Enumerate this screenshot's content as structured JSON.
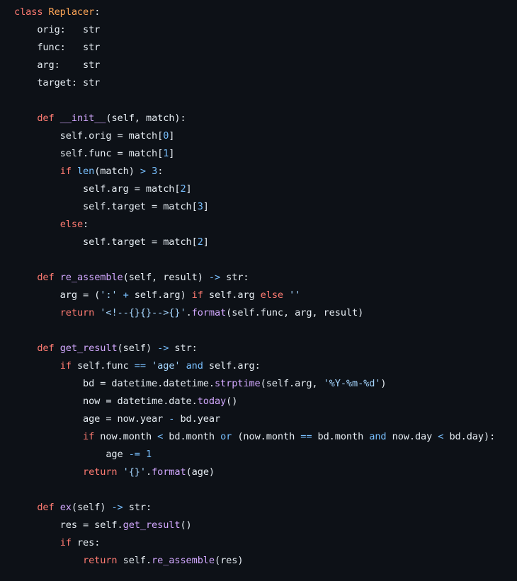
{
  "theme": {
    "background": "#0d1117",
    "text": "#e6edf3",
    "keyword": "#ff7b72",
    "class_name": "#ffa657",
    "function_name": "#d2a8ff",
    "builtin_number_operator": "#79c0ff",
    "string": "#a5d6ff"
  },
  "code": {
    "language": "python",
    "lines": [
      [
        [
          "kw",
          "class"
        ],
        [
          "tx",
          " "
        ],
        [
          "cls",
          "Replacer"
        ],
        [
          "tx",
          ":"
        ]
      ],
      [
        [
          "tx",
          "    orig:   str"
        ]
      ],
      [
        [
          "tx",
          "    func:   str"
        ]
      ],
      [
        [
          "tx",
          "    arg:    str"
        ]
      ],
      [
        [
          "tx",
          "    target: str"
        ]
      ],
      [],
      [
        [
          "tx",
          "    "
        ],
        [
          "kw",
          "def"
        ],
        [
          "tx",
          " "
        ],
        [
          "fn",
          "__init__"
        ],
        [
          "tx",
          "(self, match):"
        ]
      ],
      [
        [
          "tx",
          "        self.orig = match["
        ],
        [
          "num",
          "0"
        ],
        [
          "tx",
          "]"
        ]
      ],
      [
        [
          "tx",
          "        self.func = match["
        ],
        [
          "num",
          "1"
        ],
        [
          "tx",
          "]"
        ]
      ],
      [
        [
          "tx",
          "        "
        ],
        [
          "kw",
          "if"
        ],
        [
          "tx",
          " "
        ],
        [
          "bi",
          "len"
        ],
        [
          "tx",
          "(match) "
        ],
        [
          "op",
          ">"
        ],
        [
          "tx",
          " "
        ],
        [
          "num",
          "3"
        ],
        [
          "tx",
          ":"
        ]
      ],
      [
        [
          "tx",
          "            self.arg = match["
        ],
        [
          "num",
          "2"
        ],
        [
          "tx",
          "]"
        ]
      ],
      [
        [
          "tx",
          "            self.target = match["
        ],
        [
          "num",
          "3"
        ],
        [
          "tx",
          "]"
        ]
      ],
      [
        [
          "tx",
          "        "
        ],
        [
          "kw",
          "else"
        ],
        [
          "tx",
          ":"
        ]
      ],
      [
        [
          "tx",
          "            self.target = match["
        ],
        [
          "num",
          "2"
        ],
        [
          "tx",
          "]"
        ]
      ],
      [],
      [
        [
          "tx",
          "    "
        ],
        [
          "kw",
          "def"
        ],
        [
          "tx",
          " "
        ],
        [
          "fn",
          "re_assemble"
        ],
        [
          "tx",
          "(self, result) "
        ],
        [
          "op",
          "->"
        ],
        [
          "tx",
          " str:"
        ]
      ],
      [
        [
          "tx",
          "        arg = ("
        ],
        [
          "str",
          "':'"
        ],
        [
          "tx",
          " "
        ],
        [
          "op",
          "+"
        ],
        [
          "tx",
          " self.arg) "
        ],
        [
          "kw",
          "if"
        ],
        [
          "tx",
          " self.arg "
        ],
        [
          "kw",
          "else"
        ],
        [
          "tx",
          " "
        ],
        [
          "str",
          "''"
        ]
      ],
      [
        [
          "tx",
          "        "
        ],
        [
          "kw",
          "return"
        ],
        [
          "tx",
          " "
        ],
        [
          "str",
          "'<!--{}{}-->{}'"
        ],
        [
          "tx",
          "."
        ],
        [
          "fn",
          "format"
        ],
        [
          "tx",
          "(self.func, arg, result)"
        ]
      ],
      [],
      [
        [
          "tx",
          "    "
        ],
        [
          "kw",
          "def"
        ],
        [
          "tx",
          " "
        ],
        [
          "fn",
          "get_result"
        ],
        [
          "tx",
          "(self) "
        ],
        [
          "op",
          "->"
        ],
        [
          "tx",
          " str:"
        ]
      ],
      [
        [
          "tx",
          "        "
        ],
        [
          "kw",
          "if"
        ],
        [
          "tx",
          " self.func "
        ],
        [
          "op",
          "=="
        ],
        [
          "tx",
          " "
        ],
        [
          "str",
          "'age'"
        ],
        [
          "tx",
          " "
        ],
        [
          "op",
          "and"
        ],
        [
          "tx",
          " self.arg:"
        ]
      ],
      [
        [
          "tx",
          "            bd = datetime.datetime."
        ],
        [
          "fn",
          "strptime"
        ],
        [
          "tx",
          "(self.arg, "
        ],
        [
          "str",
          "'%Y-%m-%d'"
        ],
        [
          "tx",
          ")"
        ]
      ],
      [
        [
          "tx",
          "            now = datetime.date."
        ],
        [
          "fn",
          "today"
        ],
        [
          "tx",
          "()"
        ]
      ],
      [
        [
          "tx",
          "            age = now.year "
        ],
        [
          "op",
          "-"
        ],
        [
          "tx",
          " bd.year"
        ]
      ],
      [
        [
          "tx",
          "            "
        ],
        [
          "kw",
          "if"
        ],
        [
          "tx",
          " now.month "
        ],
        [
          "op",
          "<"
        ],
        [
          "tx",
          " bd.month "
        ],
        [
          "op",
          "or"
        ],
        [
          "tx",
          " (now.month "
        ],
        [
          "op",
          "=="
        ],
        [
          "tx",
          " bd.month "
        ],
        [
          "op",
          "and"
        ],
        [
          "tx",
          " now.day "
        ],
        [
          "op",
          "<"
        ],
        [
          "tx",
          " bd.day):"
        ]
      ],
      [
        [
          "tx",
          "                age "
        ],
        [
          "op",
          "-="
        ],
        [
          "tx",
          " "
        ],
        [
          "num",
          "1"
        ]
      ],
      [
        [
          "tx",
          "            "
        ],
        [
          "kw",
          "return"
        ],
        [
          "tx",
          " "
        ],
        [
          "str",
          "'{}'"
        ],
        [
          "tx",
          "."
        ],
        [
          "fn",
          "format"
        ],
        [
          "tx",
          "(age)"
        ]
      ],
      [],
      [
        [
          "tx",
          "    "
        ],
        [
          "kw",
          "def"
        ],
        [
          "tx",
          " "
        ],
        [
          "fn",
          "ex"
        ],
        [
          "tx",
          "(self) "
        ],
        [
          "op",
          "->"
        ],
        [
          "tx",
          " str:"
        ]
      ],
      [
        [
          "tx",
          "        res = self."
        ],
        [
          "fn",
          "get_result"
        ],
        [
          "tx",
          "()"
        ]
      ],
      [
        [
          "tx",
          "        "
        ],
        [
          "kw",
          "if"
        ],
        [
          "tx",
          " res:"
        ]
      ],
      [
        [
          "tx",
          "            "
        ],
        [
          "kw",
          "return"
        ],
        [
          "tx",
          " self."
        ],
        [
          "fn",
          "re_assemble"
        ],
        [
          "tx",
          "(res)"
        ]
      ]
    ]
  }
}
